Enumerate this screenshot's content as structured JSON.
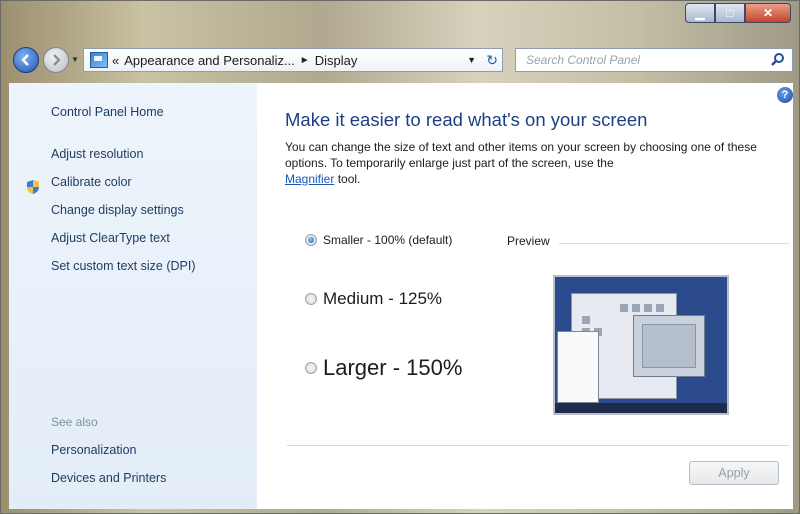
{
  "window": {
    "caption_buttons": [
      "minimize-icon",
      "maximize-icon",
      "close-icon"
    ]
  },
  "navbar": {
    "breadcrumb_prefix": "«",
    "breadcrumb": [
      "Appearance and Personaliz...",
      "Display"
    ],
    "search_placeholder": "Search Control Panel",
    "icons": [
      "back-arrow-icon",
      "forward-arrow-icon",
      "refresh-icon",
      "search-icon"
    ]
  },
  "sidebar": {
    "home": "Control Panel Home",
    "links": [
      "Adjust resolution",
      "Calibrate color",
      "Change display settings",
      "Adjust ClearType text",
      "Set custom text size (DPI)"
    ],
    "see_also_title": "See also",
    "see_also": [
      "Personalization",
      "Devices and Printers"
    ]
  },
  "main": {
    "title": "Make it easier to read what's on your screen",
    "description_1": "You can change the size of text and other items on your screen by choosing one of these options. To temporarily enlarge just part of the screen, use the",
    "magnifier_link": "Magnifier",
    "description_2": "tool.",
    "options": [
      {
        "label": "Smaller - 100% (default)",
        "checked": true
      },
      {
        "label": "Medium - 125%",
        "checked": false
      },
      {
        "label": "Larger - 150%",
        "checked": false
      }
    ],
    "preview_label": "Preview",
    "apply_label": "Apply",
    "help_glyph": "?"
  },
  "colors": {
    "link": "#1e3a5f",
    "heading": "#1e3f84",
    "sidebar_bg": "#e3edf8",
    "accent": "#1c62c9"
  }
}
